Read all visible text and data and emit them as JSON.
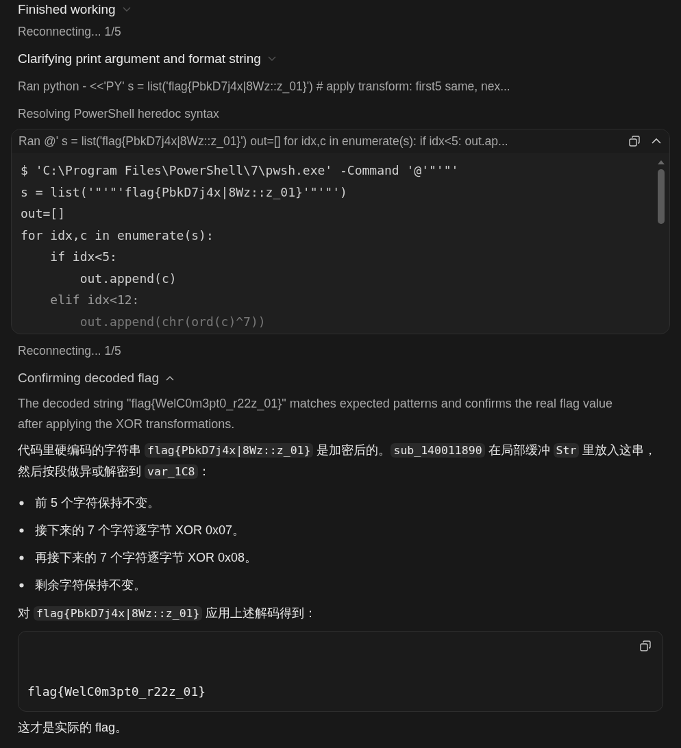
{
  "steps": [
    {
      "kind": "toggle",
      "text": "Finished working",
      "expanded": false
    },
    {
      "kind": "status",
      "text": "Reconnecting... 1/5"
    },
    {
      "kind": "toggle",
      "text": "Clarifying print argument and format string",
      "expanded": false
    },
    {
      "kind": "status",
      "text": "Ran python - <<'PY' s = list('flag{PbkD7j4x|8Wz::z_01}') # apply transform: first5 same, nex..."
    },
    {
      "kind": "status",
      "text": "Resolving PowerShell heredoc syntax"
    },
    {
      "kind": "command",
      "text": "Ran @' s = list('flag{PbkD7j4x|8Wz::z_01}') out=[] for idx,c in enumerate(s): if idx<5: out.ap...",
      "expanded": true,
      "lines": [
        "$ 'C:\\Program Files\\PowerShell\\7\\pwsh.exe' -Command '@'\"'\"'",
        "s = list('\"'\"'flag{PbkD7j4x|8Wz::z_01}'\"'\"')",
        "out=[]",
        "for idx,c in enumerate(s):",
        "    if idx<5:",
        "        out.append(c)",
        "    elif idx<12:",
        "        out.append(chr(ord(c)^7))"
      ]
    },
    {
      "kind": "status",
      "text": "Reconnecting... 1/5"
    },
    {
      "kind": "toggle",
      "text": "Confirming decoded flag",
      "expanded": true
    },
    {
      "kind": "note",
      "text": "The decoded string \"flag{WelC0m3pt0_r22z_01}\" matches expected patterns and confirms the real flag value after applying the XOR transformations."
    }
  ],
  "answer": [
    {
      "kind": "paragraph",
      "parts": [
        {
          "kind": "text",
          "text": "代码里硬编码的字符串 "
        },
        {
          "kind": "code",
          "text": "flag{PbkD7j4x|8Wz::z_01}"
        },
        {
          "kind": "text",
          "text": " 是加密后的。"
        },
        {
          "kind": "code",
          "text": "sub_140011890"
        },
        {
          "kind": "text",
          "text": " 在局部缓冲 "
        },
        {
          "kind": "code",
          "text": "Str"
        },
        {
          "kind": "text",
          "text": " 里放入这串，然后按段做异或解密到 "
        },
        {
          "kind": "code",
          "text": "var_1C8"
        },
        {
          "kind": "text",
          "text": "："
        }
      ]
    },
    {
      "kind": "bullets",
      "items": [
        "前 5 个字符保持不变。",
        "接下来的 7 个字符逐字节 XOR 0x07。",
        "再接下来的 7 个字符逐字节 XOR 0x08。",
        "剩余字符保持不变。"
      ]
    },
    {
      "kind": "paragraph",
      "parts": [
        {
          "kind": "text",
          "text": "对 "
        },
        {
          "kind": "code",
          "text": "flag{PbkD7j4x|8Wz::z_01}"
        },
        {
          "kind": "text",
          "text": " 应用上述解码得到："
        }
      ]
    },
    {
      "kind": "codeblock",
      "text": "flag{WelC0m3pt0_r22z_01}"
    },
    {
      "kind": "paragraph",
      "parts": [
        {
          "kind": "text",
          "text": "这才是实际的 flag。"
        }
      ]
    }
  ]
}
